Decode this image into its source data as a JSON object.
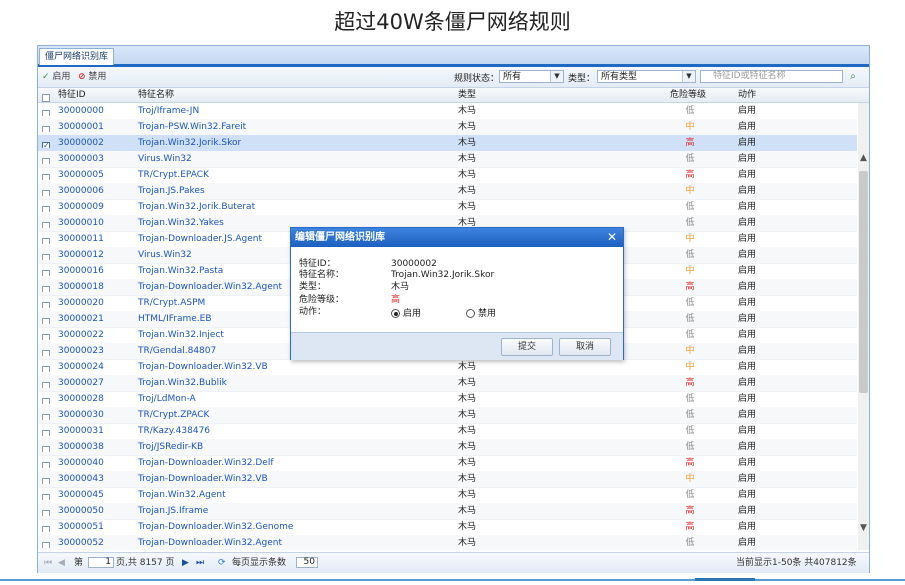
{
  "page_title": "超过40W条僵尸网络规则",
  "tab_label": "僵尸网络识别库",
  "toolbar": {
    "enable_label": "启用",
    "disable_label": "禁用",
    "rule_status_label": "规则状态：",
    "rule_status_value": "所有",
    "type_label": "类型：",
    "type_value": "所有类型",
    "search_placeholder": "特征ID或特征名称"
  },
  "columns": [
    "特征ID",
    "特征名称",
    "类型",
    "危险等级",
    "动作"
  ],
  "rows": [
    {
      "id": "30000000",
      "name": "Troj/Iframe-JN",
      "type": "木马",
      "risk": "低",
      "level": "low",
      "action": "启用"
    },
    {
      "id": "30000001",
      "name": "Trojan-PSW.Win32.Fareit",
      "type": "木马",
      "risk": "中",
      "level": "mid",
      "action": "启用"
    },
    {
      "id": "30000002",
      "name": "Trojan.Win32.Jorik.Skor",
      "type": "木马",
      "risk": "高",
      "level": "high",
      "action": "启用",
      "selected": true
    },
    {
      "id": "30000003",
      "name": "Virus.Win32",
      "type": "木马",
      "risk": "低",
      "level": "low",
      "action": "启用"
    },
    {
      "id": "30000005",
      "name": "TR/Crypt.EPACK",
      "type": "木马",
      "risk": "高",
      "level": "high",
      "action": "启用"
    },
    {
      "id": "30000006",
      "name": "Trojan.JS.Pakes",
      "type": "木马",
      "risk": "中",
      "level": "mid",
      "action": "启用"
    },
    {
      "id": "30000009",
      "name": "Trojan.Win32.Jorik.Buterat",
      "type": "木马",
      "risk": "低",
      "level": "low",
      "action": "启用"
    },
    {
      "id": "30000010",
      "name": "Trojan.Win32.Yakes",
      "type": "木马",
      "risk": "低",
      "level": "low",
      "action": "启用"
    },
    {
      "id": "30000011",
      "name": "Trojan-Downloader.JS.Agent",
      "type": "",
      "risk": "中",
      "level": "mid",
      "action": "启用"
    },
    {
      "id": "30000012",
      "name": "Virus.Win32",
      "type": "",
      "risk": "低",
      "level": "low",
      "action": "启用"
    },
    {
      "id": "30000016",
      "name": "Trojan.Win32.Pasta",
      "type": "",
      "risk": "中",
      "level": "mid",
      "action": "启用"
    },
    {
      "id": "30000018",
      "name": "Trojan-Downloader.Win32.Agent",
      "type": "",
      "risk": "高",
      "level": "high",
      "action": "启用"
    },
    {
      "id": "30000020",
      "name": "TR/Crypt.ASPM",
      "type": "",
      "risk": "低",
      "level": "low",
      "action": "启用"
    },
    {
      "id": "30000021",
      "name": "HTML/IFrame.EB",
      "type": "",
      "risk": "低",
      "level": "low",
      "action": "启用"
    },
    {
      "id": "30000022",
      "name": "Trojan.Win32.Inject",
      "type": "",
      "risk": "低",
      "level": "low",
      "action": "启用"
    },
    {
      "id": "30000023",
      "name": "TR/Gendal.84807",
      "type": "",
      "risk": "中",
      "level": "mid",
      "action": "启用"
    },
    {
      "id": "30000024",
      "name": "Trojan-Downloader.Win32.VB",
      "type": "木马",
      "risk": "中",
      "level": "mid",
      "action": "启用"
    },
    {
      "id": "30000027",
      "name": "Trojan.Win32.Bublik",
      "type": "木马",
      "risk": "高",
      "level": "high",
      "action": "启用"
    },
    {
      "id": "30000028",
      "name": "Troj/LdMon-A",
      "type": "木马",
      "risk": "低",
      "level": "low",
      "action": "启用"
    },
    {
      "id": "30000030",
      "name": "TR/Crypt.ZPACK",
      "type": "木马",
      "risk": "低",
      "level": "low",
      "action": "启用"
    },
    {
      "id": "30000031",
      "name": "TR/Kazy.438476",
      "type": "木马",
      "risk": "低",
      "level": "low",
      "action": "启用"
    },
    {
      "id": "30000038",
      "name": "Troj/JSRedir-KB",
      "type": "木马",
      "risk": "低",
      "level": "low",
      "action": "启用"
    },
    {
      "id": "30000040",
      "name": "Trojan-Downloader.Win32.Delf",
      "type": "木马",
      "risk": "高",
      "level": "high",
      "action": "启用"
    },
    {
      "id": "30000043",
      "name": "Trojan-Downloader.Win32.VB",
      "type": "木马",
      "risk": "中",
      "level": "mid",
      "action": "启用"
    },
    {
      "id": "30000045",
      "name": "Trojan.Win32.Agent",
      "type": "木马",
      "risk": "低",
      "level": "low",
      "action": "启用"
    },
    {
      "id": "30000050",
      "name": "Trojan.JS.Iframe",
      "type": "木马",
      "risk": "高",
      "level": "high",
      "action": "启用"
    },
    {
      "id": "30000051",
      "name": "Trojan-Downloader.Win32.Genome",
      "type": "木马",
      "risk": "高",
      "level": "high",
      "action": "启用"
    },
    {
      "id": "30000052",
      "name": "Trojan-Downloader.Win32.Agent",
      "type": "木马",
      "risk": "低",
      "level": "low",
      "action": "启用"
    }
  ],
  "pager": {
    "page_prefix": "第",
    "page_value": "1",
    "page_suffix": "页,共 8157 页",
    "per_page_label": "每页显示条数",
    "per_page_value": "50",
    "summary": "当前显示1-50条 共407812条"
  },
  "dialog": {
    "title": "编辑僵尸网络识别库",
    "fields": [
      {
        "label": "特征ID：",
        "value": "30000002"
      },
      {
        "label": "特征名称：",
        "value": "Trojan.Win32.Jorik.Skor"
      },
      {
        "label": "类型：",
        "value": "木马"
      },
      {
        "label": "危险等级：",
        "value": "高"
      },
      {
        "label": "动作：",
        "value": ""
      }
    ],
    "radio_enable": "启用",
    "radio_disable": "禁用",
    "submit_label": "提交",
    "cancel_label": "取消"
  },
  "colors": {
    "accent": "#1f69c2",
    "risk_high": "#e02a2a",
    "risk_mid": "#f29a24",
    "risk_low": "#888888"
  }
}
